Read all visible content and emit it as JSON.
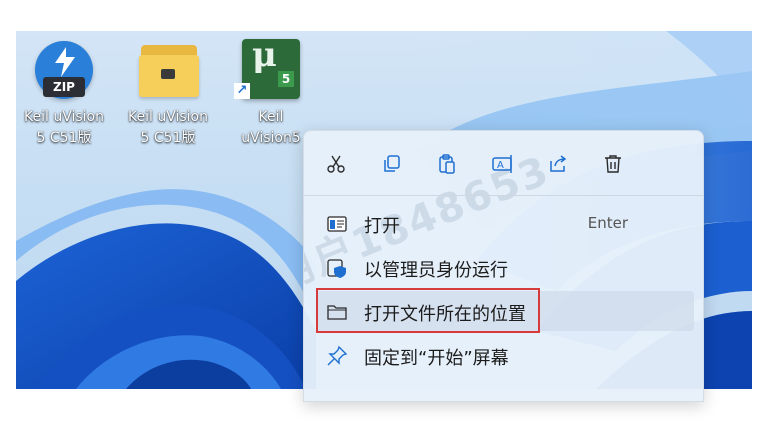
{
  "desktop": {
    "icons": [
      {
        "name": "zip-icon",
        "label": "Keil uVision\n5 C51版",
        "tag": "ZIP"
      },
      {
        "name": "folder-icon",
        "label": "Keil uVision\n5 C51版"
      },
      {
        "name": "uvision-icon",
        "label": "Keil\nuVision5",
        "badge": "5"
      }
    ]
  },
  "context_menu": {
    "toolbar_icons": [
      "cut-icon",
      "copy-icon",
      "paste-icon",
      "rename-icon",
      "share-icon",
      "delete-icon"
    ],
    "watermark": "用户1848653",
    "items": [
      {
        "label": "打开",
        "accelerator": "Enter",
        "icon": "open-app-icon"
      },
      {
        "label": "以管理员身份运行",
        "icon": "admin-shield-icon"
      },
      {
        "label": "打开文件所在的位置",
        "icon": "folder-outline-icon",
        "highlighted": true
      },
      {
        "label": "固定到“开始”屏幕",
        "icon": "pin-icon"
      }
    ]
  },
  "colors": {
    "accent": "#1f6fd1",
    "highlight_border": "#d63a3a",
    "menu_bg": "#e7f0fa"
  }
}
